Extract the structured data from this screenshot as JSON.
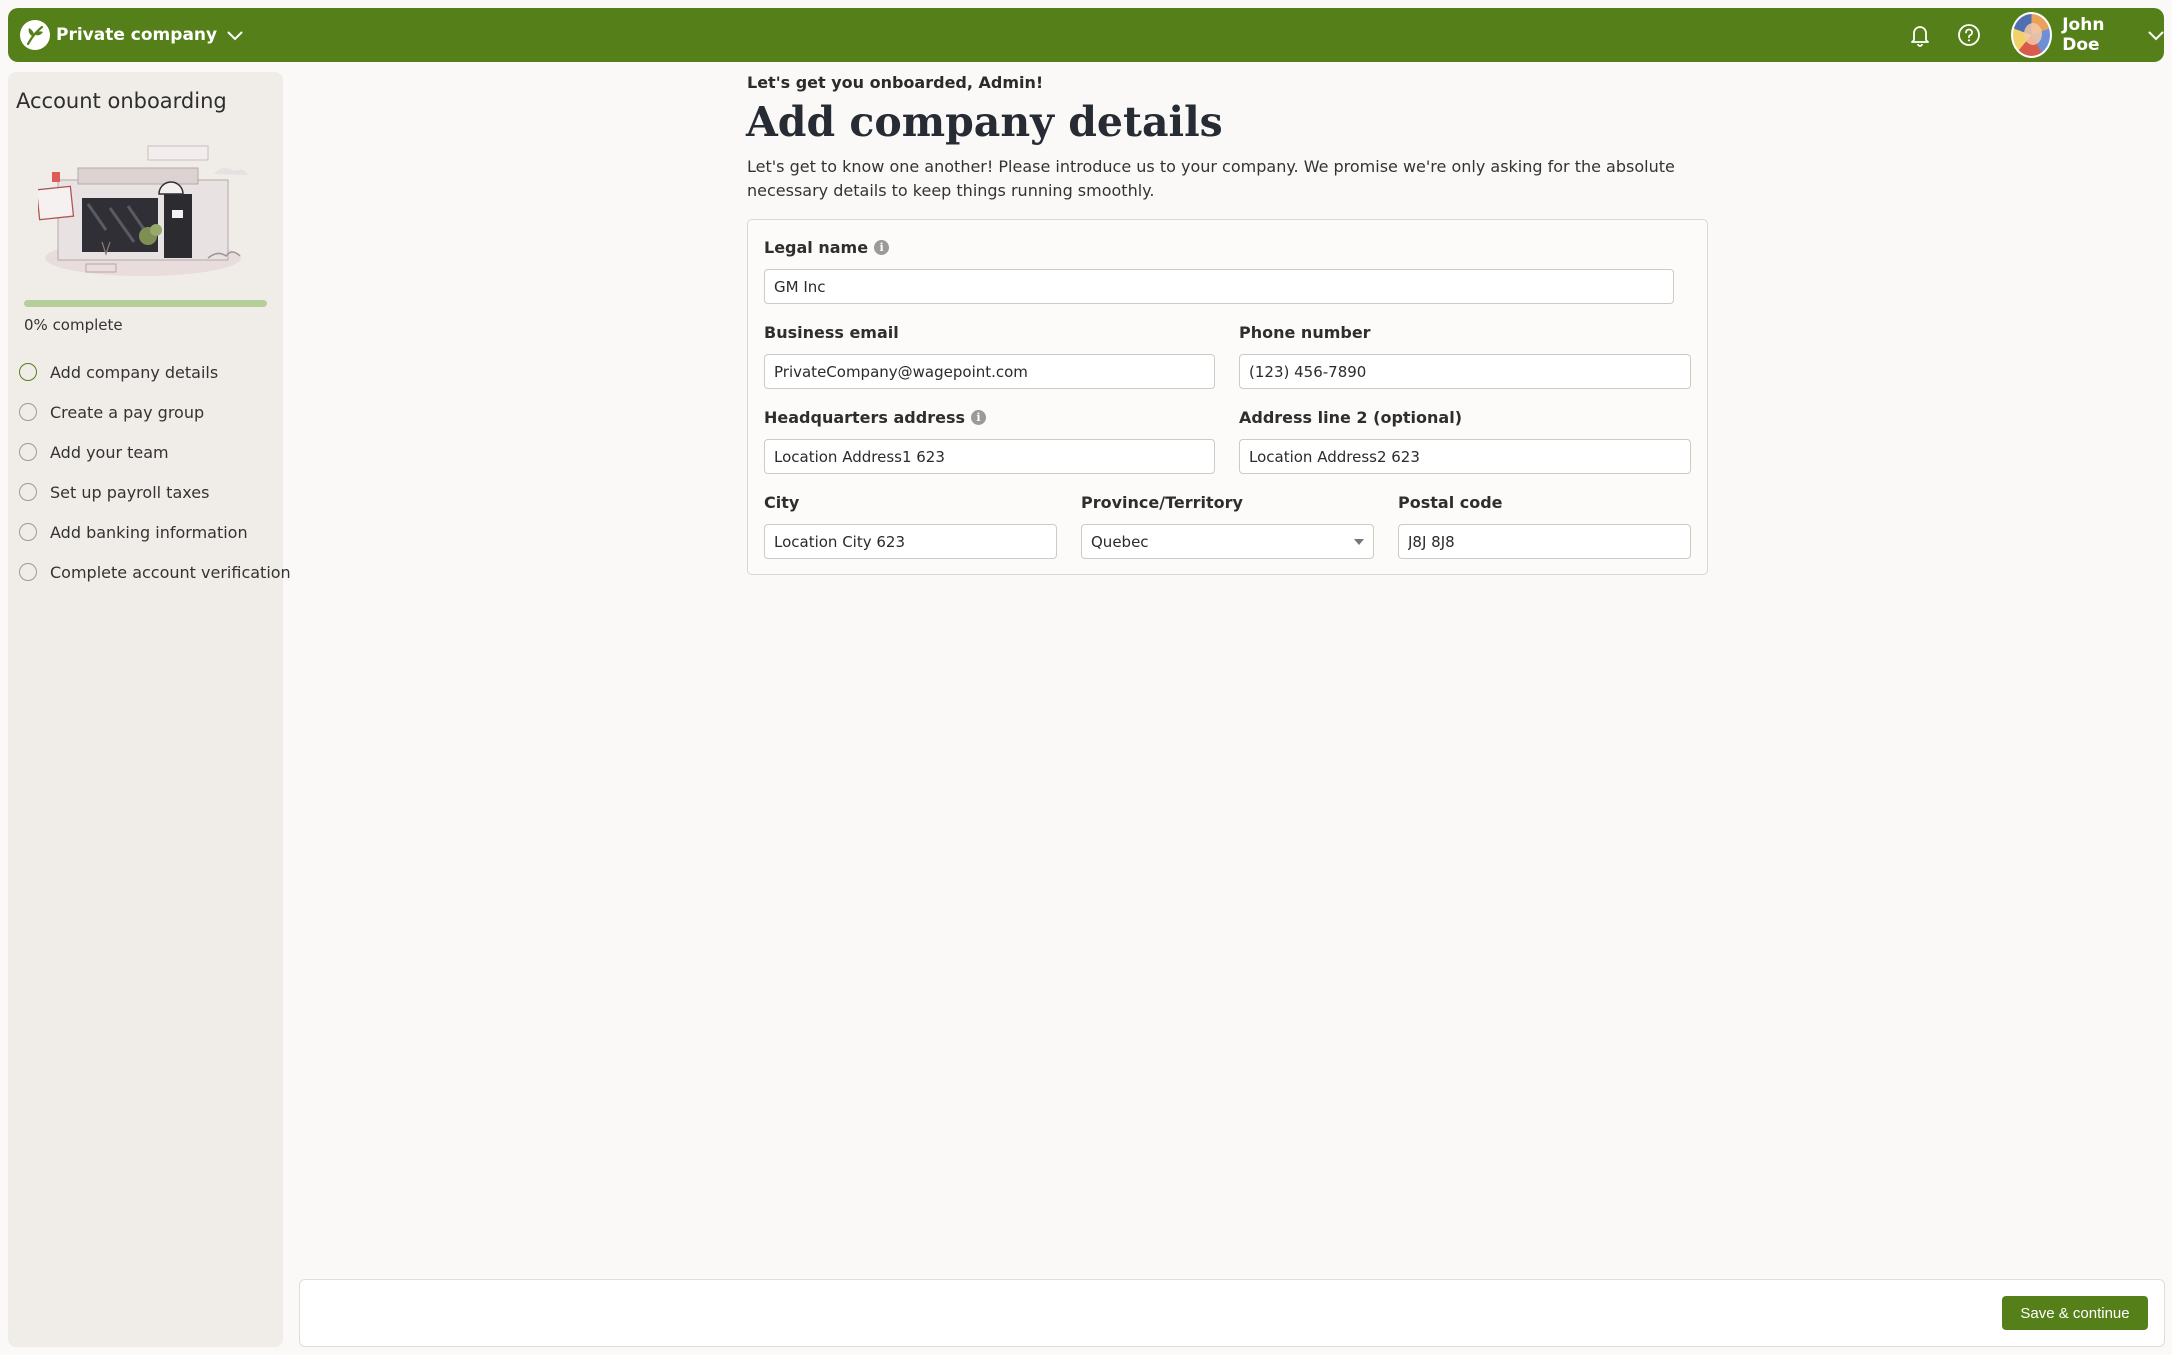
{
  "header": {
    "company_label": "Private company",
    "user_name": "John Doe",
    "brand_color": "#558019"
  },
  "sidebar": {
    "title": "Account onboarding",
    "progress": {
      "percent": 0,
      "label": "0% complete"
    },
    "steps": [
      {
        "label": "Add company details",
        "current": true
      },
      {
        "label": "Create a pay group",
        "current": false
      },
      {
        "label": "Add your team",
        "current": false
      },
      {
        "label": "Set up payroll taxes",
        "current": false
      },
      {
        "label": "Add banking information",
        "current": false
      },
      {
        "label": "Complete account verification",
        "current": false
      }
    ]
  },
  "main": {
    "eyebrow": "Let's get you onboarded, Admin!",
    "title": "Add company details",
    "intro": "Let's get to know one another! Please introduce us to your company. We promise we're only asking for the absolute necessary details to keep things running smoothly.",
    "form": {
      "legal_name": {
        "label": "Legal name",
        "value": "GM Inc"
      },
      "business_email": {
        "label": "Business email",
        "value": "PrivateCompany@wagepoint.com"
      },
      "phone_number": {
        "label": "Phone number",
        "value": "(123) 456-7890"
      },
      "hq_address": {
        "label": "Headquarters address",
        "value": "Location Address1 623"
      },
      "address_line2": {
        "label": "Address line 2 (optional)",
        "value": "Location Address2 623"
      },
      "city": {
        "label": "City",
        "value": "Location City 623"
      },
      "province": {
        "label": "Province/Territory",
        "value": "Quebec"
      },
      "postal_code": {
        "label": "Postal code",
        "value": "J8J 8J8"
      }
    }
  },
  "footer": {
    "save_label": "Save & continue"
  }
}
